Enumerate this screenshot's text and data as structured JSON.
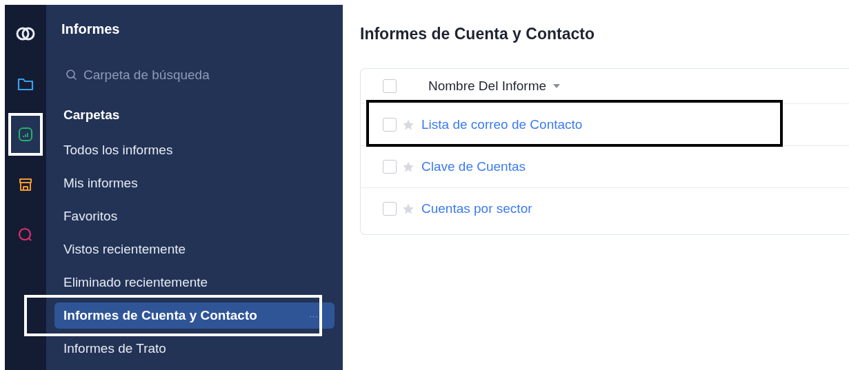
{
  "rail": [
    {
      "kind": "logo",
      "highlighted": false
    },
    {
      "kind": "folder",
      "highlighted": false
    },
    {
      "kind": "reports",
      "highlighted": true
    },
    {
      "kind": "store",
      "highlighted": false
    },
    {
      "kind": "search",
      "highlighted": false
    }
  ],
  "sidebar": {
    "title": "Informes",
    "search": {
      "placeholder": "Carpeta de búsqueda"
    },
    "section": "Carpetas",
    "items": [
      {
        "label": "Todos los informes",
        "selected": false,
        "highlighted": false
      },
      {
        "label": "Mis informes",
        "selected": false,
        "highlighted": false
      },
      {
        "label": "Favoritos",
        "selected": false,
        "highlighted": false
      },
      {
        "label": "Vistos recientemente",
        "selected": false,
        "highlighted": false
      },
      {
        "label": "Eliminado recientemente",
        "selected": false,
        "highlighted": false
      },
      {
        "label": "Informes de Cuenta y Contacto",
        "selected": true,
        "highlighted": true,
        "more": "···"
      },
      {
        "label": "Informes de Trato",
        "selected": false,
        "highlighted": false
      }
    ]
  },
  "main": {
    "title": "Informes de Cuenta y Contacto",
    "table": {
      "header": {
        "label": "Nombre Del Informe",
        "checked": false
      },
      "rows": [
        {
          "name": "Lista de correo de Contacto",
          "checked": false,
          "starred": false,
          "highlighted": true
        },
        {
          "name": "Clave de Cuentas",
          "checked": false,
          "starred": false,
          "highlighted": false
        },
        {
          "name": "Cuentas por sector",
          "checked": false,
          "starred": false,
          "highlighted": false
        }
      ]
    }
  }
}
